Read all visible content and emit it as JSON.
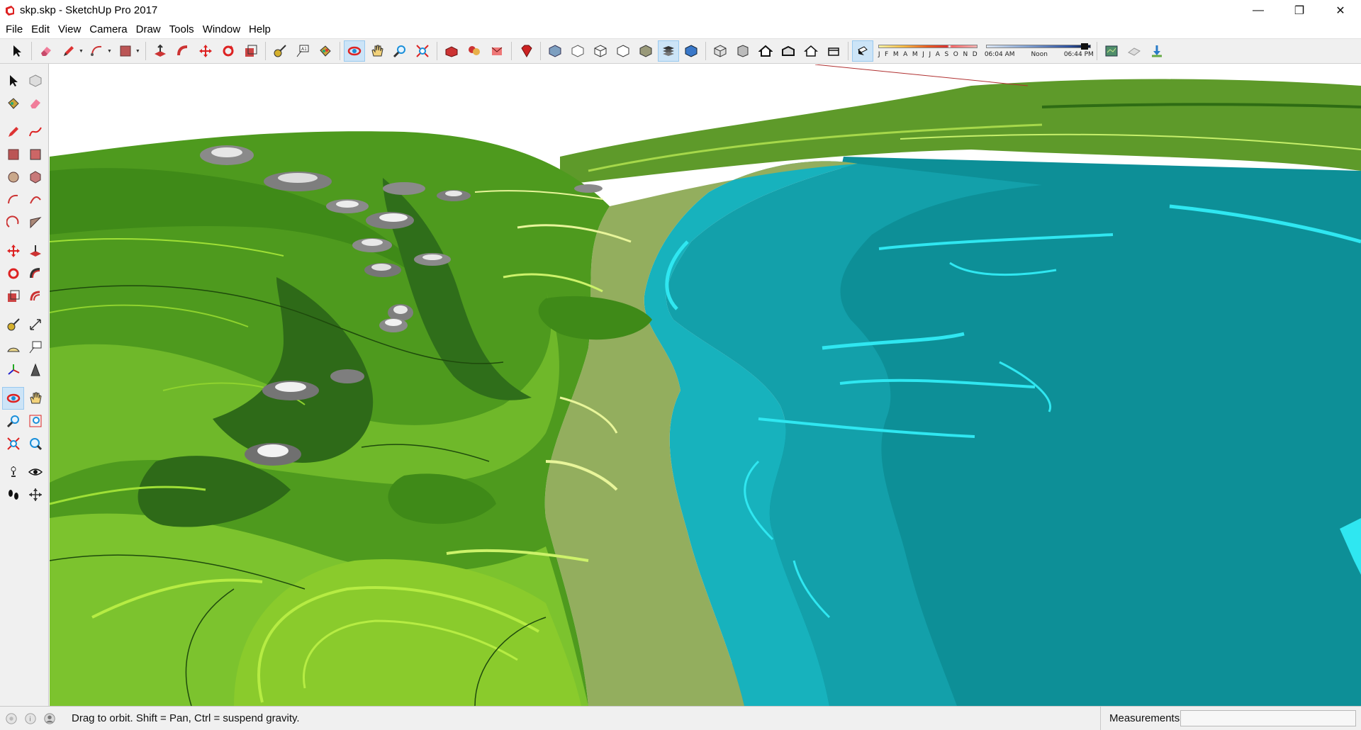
{
  "window": {
    "title": "skp.skp - SketchUp Pro 2017",
    "controls": {
      "minimize": "—",
      "restore": "❐",
      "close": "✕"
    }
  },
  "menu": [
    "File",
    "Edit",
    "View",
    "Camera",
    "Draw",
    "Tools",
    "Window",
    "Help"
  ],
  "shadows": {
    "months": [
      "J",
      "F",
      "M",
      "A",
      "M",
      "J",
      "J",
      "A",
      "S",
      "O",
      "N",
      "D"
    ],
    "time_start": "06:04 AM",
    "time_mid": "Noon",
    "time_end": "06:44 PM"
  },
  "status": {
    "hint": "Drag to orbit. Shift = Pan, Ctrl = suspend gravity.",
    "measurements_label": "Measurements",
    "measurements_value": ""
  },
  "colors": {
    "toolbar_bg": "#f0f0f0",
    "active_tool": "#cce4f7",
    "terrain_dark": "#2f6e1a",
    "terrain_mid": "#4e9a1e",
    "terrain_light": "#8acb2c",
    "terrain_lime": "#b6ec43",
    "shore": "#93ae5e",
    "water_light": "#1ab6c1",
    "water_deep": "#0d8f97",
    "water_edge": "#2fe7f1"
  }
}
